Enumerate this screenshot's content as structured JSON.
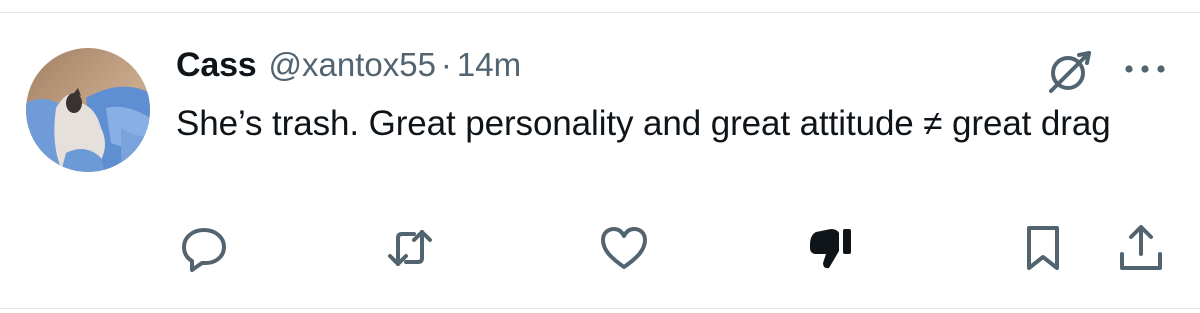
{
  "tweet": {
    "display_name": "Cass",
    "handle": "@xantox55",
    "separator": "·",
    "time": "14m",
    "text": "She’s trash. Great personality and great attitude ≠ great drag"
  },
  "icons": {
    "header": [
      "grok-icon",
      "more-icon"
    ],
    "actions": [
      "reply-icon",
      "retweet-icon",
      "like-icon",
      "dislike-icon",
      "bookmark-icon",
      "share-icon"
    ]
  },
  "colors": {
    "text": "#0f1419",
    "secondary": "#536471",
    "divider": "#e3e6e8"
  }
}
